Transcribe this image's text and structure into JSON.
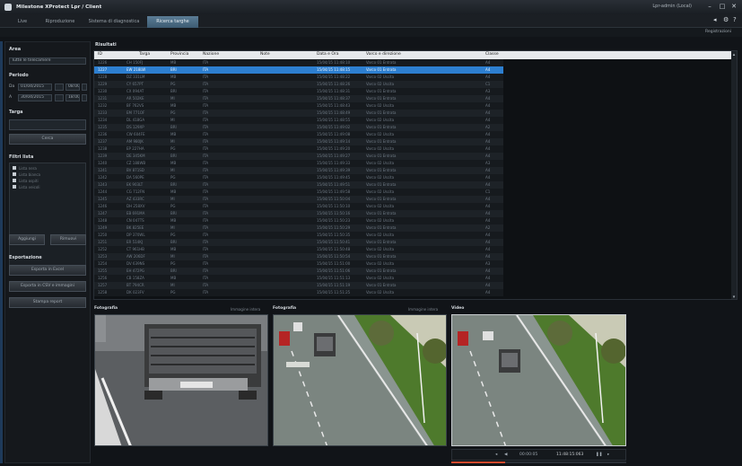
{
  "window": {
    "title": "Milestone XProtect Lpr / Client",
    "user": "Lpr-admin (Local)",
    "minimize": "–",
    "maximize": "□",
    "close": "✕"
  },
  "tabs": [
    {
      "label": "Live"
    },
    {
      "label": "Riproduzione"
    },
    {
      "label": "Sistema di diagnostica"
    },
    {
      "label": "Ricerca targhe"
    }
  ],
  "toolbar": {
    "right_label": "Registrazioni",
    "back_icon": "◂",
    "settings_icon": "⚙",
    "help_icon": "?"
  },
  "left": {
    "area_label": "Area",
    "area_value": "Tutte le telecamere",
    "period_label": "Periodo",
    "from_label": "Da",
    "from_date": "01/04/2015",
    "from_time": "08:00",
    "to_label": "A",
    "to_date": "30/04/2015",
    "to_time": "18:00",
    "plate_label": "Targa",
    "plate_value": "",
    "search_button": "Cerca",
    "filter_label": "Filtri lista",
    "filters": [
      "Lista nera",
      "Lista bianca",
      "Lista ospiti",
      "Lista veicoli"
    ],
    "add_button": "Aggiungi",
    "remove_button": "Rimuovi",
    "export_label": "Esportazione",
    "export_buttons": [
      "Esporta in Excel",
      "Esporta in CSV e immagini",
      "Stampa report"
    ]
  },
  "results": {
    "title": "Risultati",
    "columns": [
      "ID",
      "Targa",
      "Provincia",
      "Nazione",
      "Note",
      "Data e Ora",
      "Varco e direzione",
      "Classe"
    ],
    "rows": [
      [
        "1226",
        "CH 150FJ",
        "MB",
        "ITA",
        "",
        "15/04/15 11:48:10",
        "Varco 01 Entrata",
        "A4"
      ],
      [
        "1227",
        "EW 218LW",
        "BRI",
        "ITA",
        "",
        "15/04/15 11:48:15",
        "Varco 01 Entrata",
        "A4"
      ],
      [
        "1228",
        "DZ 331LM",
        "MB",
        "ITA",
        "",
        "15/04/15 11:48:22",
        "Varco 02 Uscita",
        "A4"
      ],
      [
        "1229",
        "CY 657PT",
        "PG",
        "ITA",
        "",
        "15/04/15 11:48:26",
        "Varco 02 Uscita",
        "C1"
      ],
      [
        "1230",
        "CX 094AT",
        "BRI",
        "ITA",
        "",
        "15/04/15 11:48:31",
        "Varco 01 Entrata",
        "A3"
      ],
      [
        "1231",
        "AR 502KE",
        "MI",
        "ITA",
        "",
        "15/04/15 11:48:37",
        "Varco 01 Entrata",
        "A4"
      ],
      [
        "1232",
        "BF 762VS",
        "MB",
        "ITA",
        "",
        "15/04/15 11:48:43",
        "Varco 02 Uscita",
        "A4"
      ],
      [
        "1233",
        "EM 771OF",
        "PG",
        "ITA",
        "",
        "15/04/15 11:48:49",
        "Varco 01 Entrata",
        "A4"
      ],
      [
        "1234",
        "DL 418GA",
        "MI",
        "ITA",
        "",
        "15/04/15 11:48:55",
        "Varco 02 Uscita",
        "A4"
      ],
      [
        "1235",
        "DS 129XP",
        "BRI",
        "ITA",
        "",
        "15/04/15 11:49:02",
        "Varco 01 Entrata",
        "A2"
      ],
      [
        "1236",
        "CW 604FE",
        "MB",
        "ITA",
        "",
        "15/04/15 11:49:08",
        "Varco 02 Uscita",
        "A4"
      ],
      [
        "1237",
        "AM 980JK",
        "MI",
        "ITA",
        "",
        "15/04/15 11:49:14",
        "Varco 01 Entrata",
        "A4"
      ],
      [
        "1238",
        "EP 227HA",
        "PG",
        "ITA",
        "",
        "15/04/15 11:49:20",
        "Varco 02 Uscita",
        "A4"
      ],
      [
        "1239",
        "DE 345KM",
        "BRI",
        "ITA",
        "",
        "15/04/15 11:49:27",
        "Varco 01 Entrata",
        "A4"
      ],
      [
        "1240",
        "CZ 188WB",
        "MB",
        "ITA",
        "",
        "15/04/15 11:49:33",
        "Varco 02 Uscita",
        "A3"
      ],
      [
        "1241",
        "BV 871SD",
        "MI",
        "ITA",
        "",
        "15/04/15 11:49:39",
        "Varco 01 Entrata",
        "A4"
      ],
      [
        "1242",
        "DA 560PE",
        "PG",
        "ITA",
        "",
        "15/04/15 11:49:45",
        "Varco 02 Uscita",
        "A4"
      ],
      [
        "1243",
        "EK 903LT",
        "BRI",
        "ITA",
        "",
        "15/04/15 11:49:51",
        "Varco 01 Entrata",
        "A4"
      ],
      [
        "1244",
        "CG 712FN",
        "MB",
        "ITA",
        "",
        "15/04/15 11:49:58",
        "Varco 02 Uscita",
        "C1"
      ],
      [
        "1245",
        "AZ 433RC",
        "MI",
        "ITA",
        "",
        "15/04/15 11:50:04",
        "Varco 01 Entrata",
        "A4"
      ],
      [
        "1246",
        "DH 258XV",
        "PG",
        "ITA",
        "",
        "15/04/15 11:50:10",
        "Varco 02 Uscita",
        "A4"
      ],
      [
        "1247",
        "EB 691MA",
        "BRI",
        "ITA",
        "",
        "15/04/15 11:50:16",
        "Varco 01 Entrata",
        "A4"
      ],
      [
        "1248",
        "CN 047TS",
        "MB",
        "ITA",
        "",
        "15/04/15 11:50:23",
        "Varco 02 Uscita",
        "A4"
      ],
      [
        "1249",
        "BK 825EE",
        "MI",
        "ITA",
        "",
        "15/04/15 11:50:29",
        "Varco 01 Entrata",
        "A2"
      ],
      [
        "1250",
        "DP 370WL",
        "PG",
        "ITA",
        "",
        "15/04/15 11:50:35",
        "Varco 02 Uscita",
        "A4"
      ],
      [
        "1251",
        "ER 514KJ",
        "BRI",
        "ITA",
        "",
        "15/04/15 11:50:41",
        "Varco 01 Entrata",
        "A4"
      ],
      [
        "1252",
        "CT 961HB",
        "MB",
        "ITA",
        "",
        "15/04/15 11:50:48",
        "Varco 02 Uscita",
        "A4"
      ],
      [
        "1253",
        "AW 206DF",
        "MI",
        "ITA",
        "",
        "15/04/15 11:50:54",
        "Varco 01 Entrata",
        "A4"
      ],
      [
        "1254",
        "DV 639NS",
        "PG",
        "ITA",
        "",
        "15/04/15 11:51:00",
        "Varco 02 Uscita",
        "A3"
      ],
      [
        "1255",
        "EH 472PG",
        "BRI",
        "ITA",
        "",
        "15/04/15 11:51:06",
        "Varco 01 Entrata",
        "A4"
      ],
      [
        "1256",
        "CB 158ZA",
        "MB",
        "ITA",
        "",
        "15/04/15 11:51:13",
        "Varco 02 Uscita",
        "A4"
      ],
      [
        "1257",
        "BT 794CR",
        "MI",
        "ITA",
        "",
        "15/04/15 11:51:19",
        "Varco 01 Entrata",
        "A4"
      ],
      [
        "1258",
        "DK 023FV",
        "PG",
        "ITA",
        "",
        "15/04/15 11:51:25",
        "Varco 02 Uscita",
        "A4"
      ]
    ],
    "selected_index": 1
  },
  "images": {
    "panel1_label": "Fotografia",
    "panel1_right": "Immagine intera",
    "panel2_label": "Fotografia",
    "panel2_right": "Immagine intera",
    "panel3_label": "Video"
  },
  "video": {
    "prev_icon": "◂",
    "play_icon": "◀",
    "position": "00:00:05",
    "timestamp": "11:48:15:063",
    "pause_icon": "❚❚",
    "next_icon": "▸",
    "progress": 0.31
  }
}
